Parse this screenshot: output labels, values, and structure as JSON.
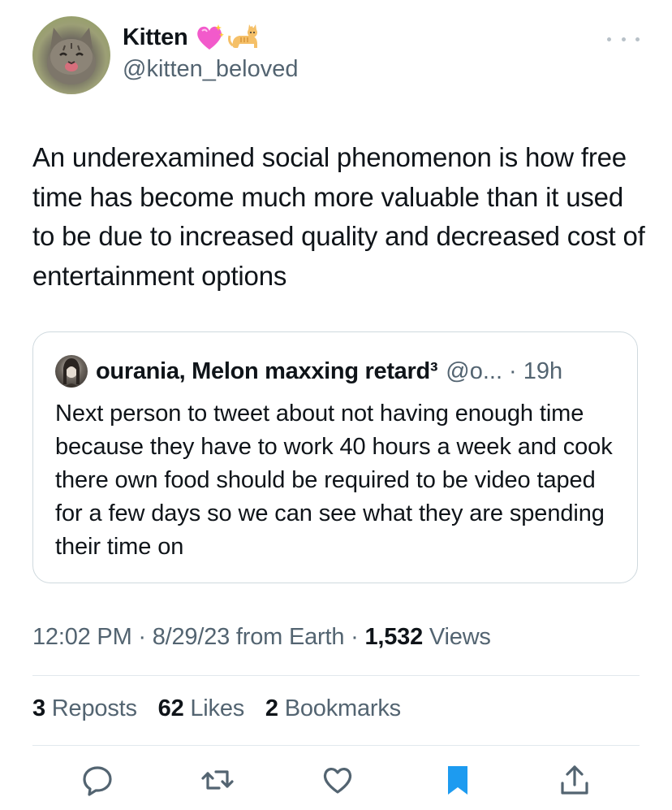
{
  "author": {
    "display_name": "Kitten",
    "handle": "@kitten_beloved",
    "emoji_1": "sparkling-heart",
    "emoji_2": "cat"
  },
  "tweet": {
    "text": "An underexamined social phenomenon is how free time has become much more valuable than it used to be due to increased quality and decreased cost of entertainment options"
  },
  "quoted_tweet": {
    "author_name": "ourania, Melon maxxing retard³",
    "meta": "@o... · 19h",
    "text": "Next person to tweet about not having enough time because they have to work 40 hours a week and cook there own food should be required to be video taped for a few days so we can see what they are spending their time on"
  },
  "meta": {
    "time_date_source": "12:02 PM · 8/29/23 from Earth · ",
    "views_count": "1,532",
    "views_label": " Views"
  },
  "stats": {
    "reposts_count": "3",
    "reposts_label": " Reposts",
    "likes_count": "62",
    "likes_label": " Likes",
    "bookmarks_count": "2",
    "bookmarks_label": " Bookmarks"
  },
  "actions": [
    "reply-icon",
    "repost-icon",
    "like-icon",
    "bookmark-icon",
    "share-icon"
  ],
  "colors": {
    "text": "#0f1419",
    "secondary": "#536471",
    "bookmark_blue": "#1d9bf0",
    "border": "#cfd9de"
  }
}
